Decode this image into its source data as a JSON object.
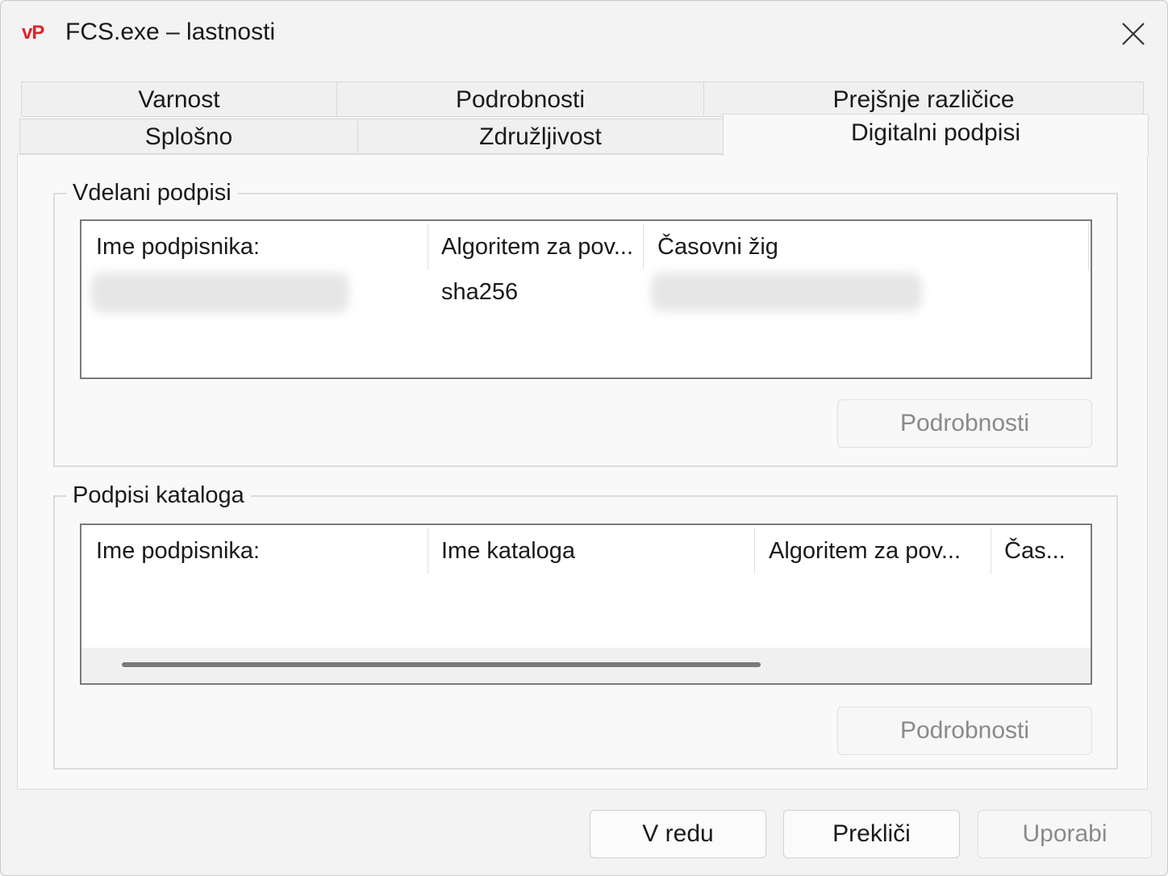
{
  "window": {
    "app_icon_text": "vP",
    "title": "FCS.exe – lastnosti"
  },
  "tabs": {
    "row1": [
      "Varnost",
      "Podrobnosti",
      "Prejšnje različice"
    ],
    "row2": [
      "Splošno",
      "Združljivost",
      "Digitalni podpisi"
    ],
    "active": "Digitalni podpisi"
  },
  "embedded": {
    "legend": "Vdelani podpisi",
    "columns": [
      "Ime podpisnika:",
      "Algoritem za pov...",
      "Časovni žig"
    ],
    "rows": [
      {
        "signer": "",
        "algorithm": "sha256",
        "timestamp": ""
      }
    ],
    "details_button": "Podrobnosti"
  },
  "catalog": {
    "legend": "Podpisi kataloga",
    "columns": [
      "Ime podpisnika:",
      "Ime kataloga",
      "Algoritem za pov...",
      "Čas..."
    ],
    "rows": [],
    "details_button": "Podrobnosti"
  },
  "footer": {
    "ok": "V redu",
    "cancel": "Prekliči",
    "apply": "Uporabi"
  },
  "colors": {
    "app_icon": "#d8262e",
    "list_border": "#7a7a7a",
    "disabled_text": "#8a8a8a"
  }
}
